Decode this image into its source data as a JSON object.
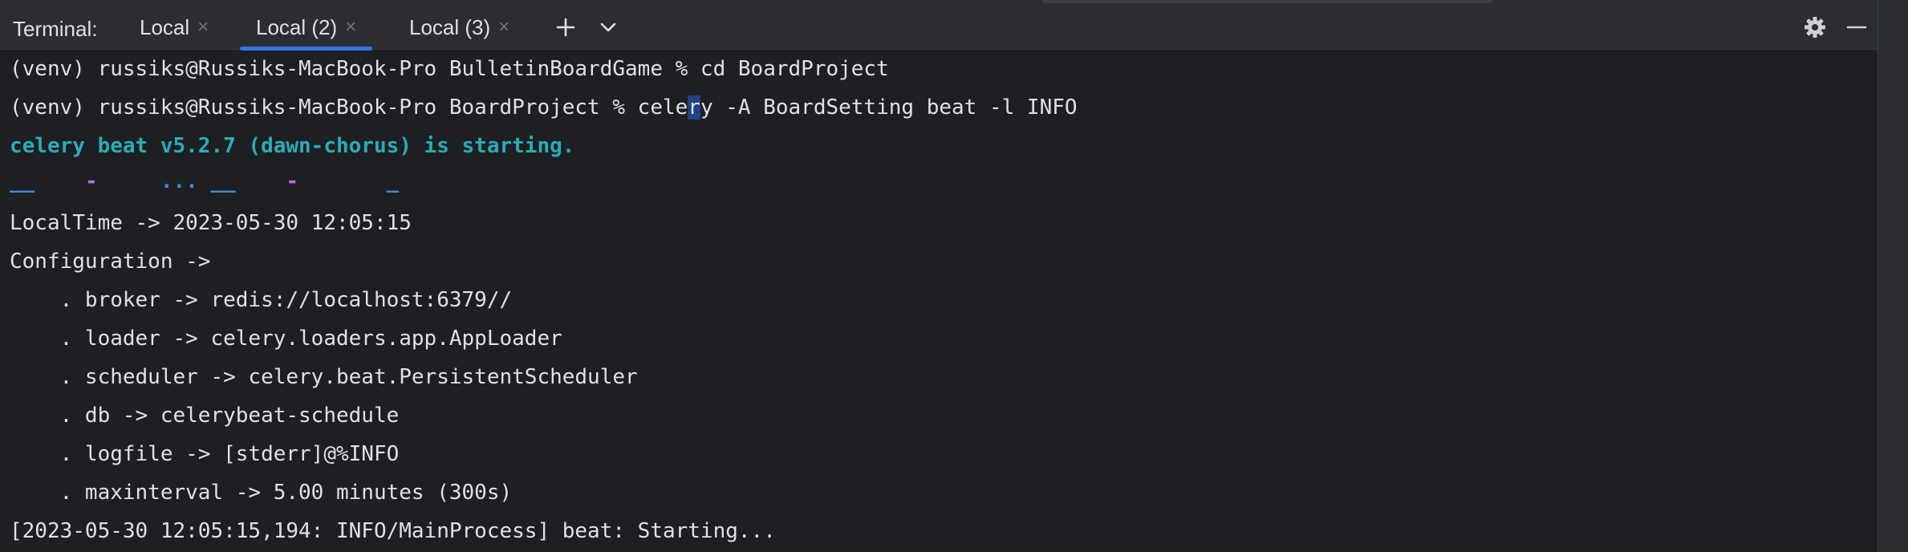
{
  "tabbar": {
    "title": "Terminal:",
    "tabs": [
      {
        "label": "Local"
      },
      {
        "label": "Local (2)",
        "active": true
      },
      {
        "label": "Local (3)"
      }
    ],
    "close_glyph": "×",
    "icons": {
      "add": "plus-icon",
      "dropdown": "chevron-down-icon",
      "settings": "gear-icon",
      "minimize": "minimize-icon"
    }
  },
  "terminal": {
    "line1": "(venv) russiks@Russiks-MacBook-Pro BulletinBoardGame % cd BoardProject",
    "line2_before": "(venv) russiks@Russiks-MacBook-Pro BoardProject % cele",
    "line2_cursor": "r",
    "line2_after": "y -A BoardSetting beat -l INFO",
    "line3": "celery beat v5.2.7 (dawn-chorus) is starting.",
    "banner": {
      "p1": "__",
      "p2": "-",
      "p3": "... __",
      "p4": "-",
      "p5": "_"
    },
    "lines": [
      "LocalTime -> 2023-05-30 12:05:15",
      "Configuration ->",
      "    . broker -> redis://localhost:6379//",
      "    . loader -> celery.loaders.app.AppLoader",
      "    . scheduler -> celery.beat.PersistentScheduler",
      "    . db -> celerybeat-schedule",
      "    . logfile -> [stderr]@%INFO",
      "    . maxinterval -> 5.00 minutes (300s)",
      "[2023-05-30 12:05:15,194: INFO/MainProcess] beat: Starting..."
    ]
  },
  "colors": {
    "background": "#1e1f22",
    "text": "#dfe1e5",
    "cyan": "#2aacb8",
    "accent": "#3574f0",
    "banner_blue": "#3f8ad8",
    "banner_purple": "#b670d6"
  }
}
